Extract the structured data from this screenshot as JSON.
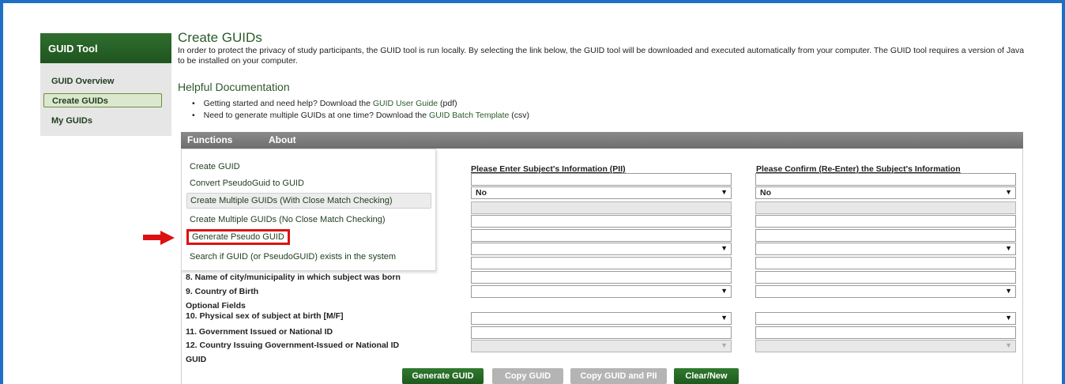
{
  "sidebar": {
    "title": "GUID Tool",
    "items": [
      {
        "label": "GUID Overview"
      },
      {
        "label": "Create GUIDs"
      },
      {
        "label": "My GUIDs"
      }
    ]
  },
  "page": {
    "title": "Create GUIDs",
    "intro": "In order to protect the privacy of study participants, the GUID tool is run locally. By selecting the link below, the GUID tool will be downloaded and executed automatically from your computer. The GUID tool requires a version of Java to be installed on your computer."
  },
  "docs": {
    "title": "Helpful Documentation",
    "items": [
      {
        "prefix": "Getting started and need help? Download the ",
        "link": "GUID User Guide",
        "suffix": " (pdf)"
      },
      {
        "prefix": "Need to generate multiple GUIDs at one time? Download the ",
        "link": "GUID Batch Template",
        "suffix": " (csv)"
      }
    ]
  },
  "menubar": {
    "functions": "Functions",
    "about": "About"
  },
  "functions_menu": [
    "Create GUID",
    "Convert PseudoGuid to GUID",
    "Create Multiple GUIDs (With Close Match Checking)",
    "Create Multiple GUIDs (No Close Match Checking)",
    "Generate Pseudo GUID",
    "Search if GUID (or PseudoGUID) exists in the system"
  ],
  "form": {
    "col1_header": "Please Enter Subject's Information (PII)",
    "col2_header": "Please Confirm (Re-Enter) the Subject's Information",
    "select_value": "No",
    "labels": {
      "city": "8.  Name of city/municipality in which subject was born",
      "country": "9.  Country of Birth",
      "optional": "Optional Fields",
      "sex": "10. Physical sex of subject at birth [M/F]",
      "gov_id": "11. Government Issued or National ID",
      "gov_country": "12. Country Issuing Government-Issued or National ID",
      "guid": "GUID"
    }
  },
  "buttons": {
    "generate": "Generate GUID",
    "copy": "Copy GUID",
    "copy_pii": "Copy GUID and PII",
    "clear": "Clear/New"
  },
  "colors": {
    "frame": "#1f6fc5",
    "brand_green": "#2f6e2f",
    "highlight_red": "#dd1111"
  }
}
